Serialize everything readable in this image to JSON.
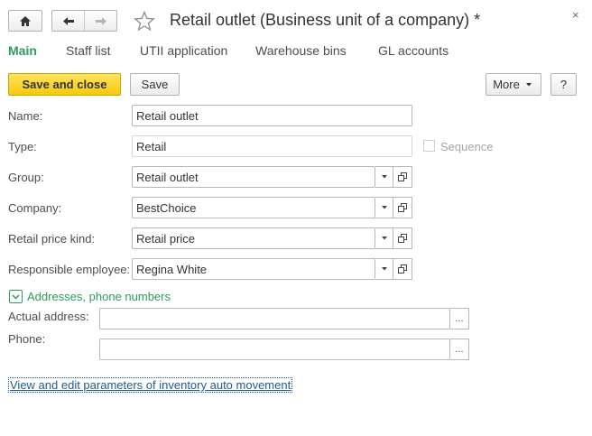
{
  "window": {
    "title": "Retail outlet (Business unit of a company) *",
    "close_glyph": "×"
  },
  "tabs": [
    {
      "label": "Main",
      "active": true
    },
    {
      "label": "Staff list"
    },
    {
      "label": "UTII application"
    },
    {
      "label": "Warehouse bins"
    },
    {
      "label": "GL accounts"
    }
  ],
  "toolbar": {
    "save_close_label": "Save and close",
    "save_label": "Save",
    "more_label": "More",
    "help_label": "?"
  },
  "form": {
    "name": {
      "label": "Name:",
      "value": "Retail outlet"
    },
    "type": {
      "label": "Type:",
      "value": "Retail"
    },
    "sequence": {
      "label": "Sequence",
      "checked": false
    },
    "group": {
      "label": "Group:",
      "value": "Retail outlet"
    },
    "company": {
      "label": "Company:",
      "value": "BestChoice"
    },
    "price_kind": {
      "label": "Retail price kind:",
      "value": "Retail price"
    },
    "employee": {
      "label": "Responsible employee:",
      "value": "Regina White"
    }
  },
  "contacts": {
    "group_title": "Addresses, phone numbers",
    "expanded": true,
    "actual_address": {
      "label": "Actual address:",
      "value": ""
    },
    "phone": {
      "label": "Phone:",
      "value": ""
    },
    "ellipsis": "..."
  },
  "link": {
    "label": "View and edit parameters of inventory auto movement"
  },
  "colors": {
    "accent_green": "#2e9c5a",
    "primary_button": "#f6c90e",
    "link": "#245b8f"
  },
  "icons": [
    "home-icon",
    "back-arrow-icon",
    "forward-arrow-icon",
    "favorite-star-icon",
    "close-icon",
    "dropdown-icon",
    "open-icon",
    "chevron-down-icon"
  ]
}
